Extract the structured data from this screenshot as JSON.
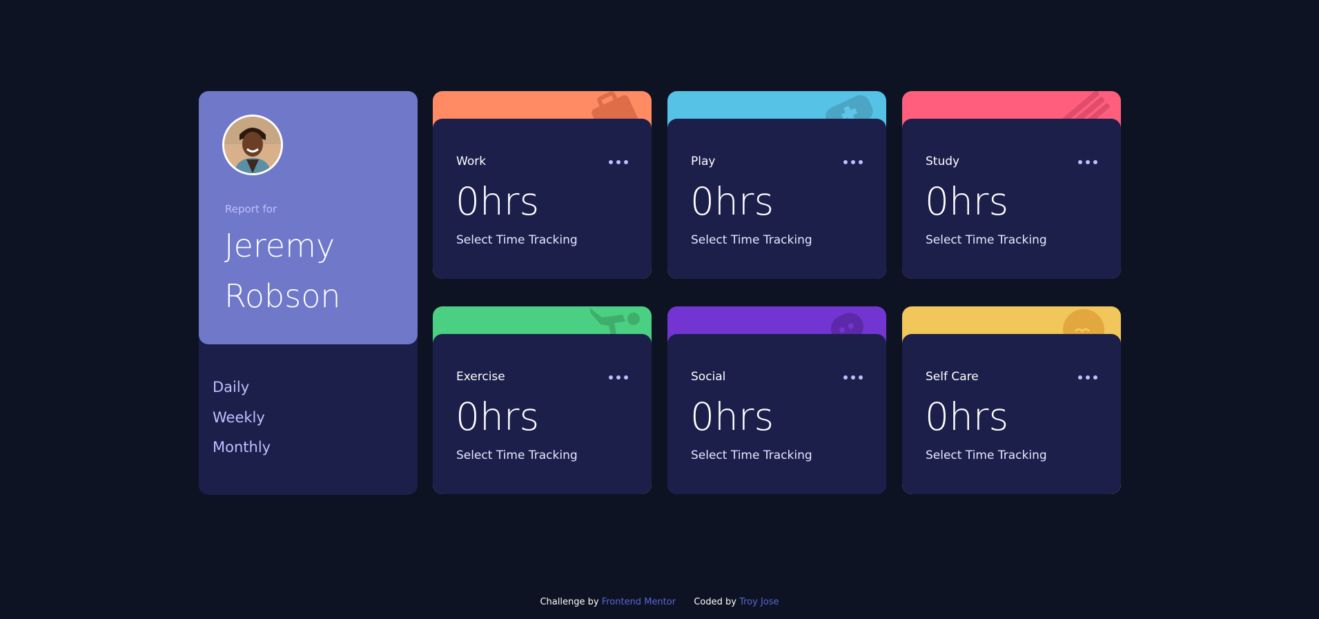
{
  "profile": {
    "report_for": "Report for",
    "first_name": "Jeremy",
    "last_name": "Robson",
    "avatar_icon": "person-avatar-icon"
  },
  "periods": [
    {
      "label": "Daily"
    },
    {
      "label": "Weekly"
    },
    {
      "label": "Monthly"
    }
  ],
  "cards": [
    {
      "title": "Work",
      "hours": "0hrs",
      "subtitle": "Select Time Tracking",
      "color": "#ff8b64",
      "icon": "briefcase-icon"
    },
    {
      "title": "Play",
      "hours": "0hrs",
      "subtitle": "Select Time Tracking",
      "color": "#55c2e6",
      "icon": "gamepad-icon"
    },
    {
      "title": "Study",
      "hours": "0hrs",
      "subtitle": "Select Time Tracking",
      "color": "#ff5e7d",
      "icon": "books-icon"
    },
    {
      "title": "Exercise",
      "hours": "0hrs",
      "subtitle": "Select Time Tracking",
      "color": "#4bcf82",
      "icon": "running-person-icon"
    },
    {
      "title": "Social",
      "hours": "0hrs",
      "subtitle": "Select Time Tracking",
      "color": "#7335d2",
      "icon": "chat-bubble-icon"
    },
    {
      "title": "Self Care",
      "hours": "0hrs",
      "subtitle": "Select Time Tracking",
      "color": "#f1c75b",
      "icon": "heart-icon"
    }
  ],
  "footer": {
    "challenge_by": "Challenge by",
    "challenge_link": "Frontend Mentor",
    "coded_by": "Coded by",
    "coded_link": "Troy Jose"
  },
  "colors": {
    "background": "#0e1323",
    "card": "#1c1f4a",
    "profile": "#7078c9",
    "muted": "#bdc1ff",
    "link": "#5a66d6"
  }
}
